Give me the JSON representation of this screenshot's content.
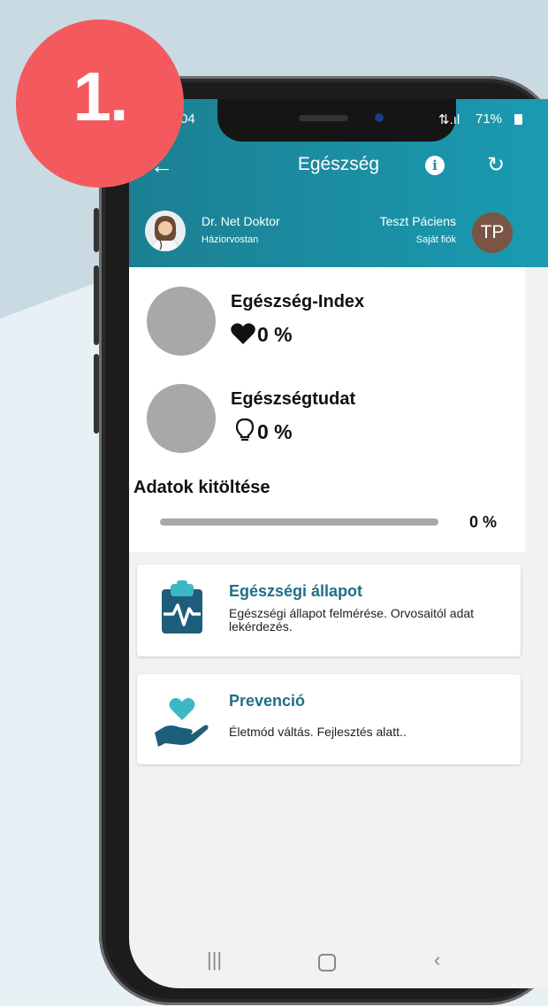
{
  "badge": {
    "number": "1."
  },
  "status_bar": {
    "time": "04",
    "signal": "⇅.ıl",
    "battery": "71%"
  },
  "toolbar": {
    "back_icon": "arrow-left-icon",
    "title": "Egészség",
    "info_icon": "info-icon",
    "refresh_icon": "refresh-icon"
  },
  "doctor": {
    "name": "Dr. Net Doktor",
    "role": "Háziorvostan"
  },
  "patient": {
    "name": "Teszt Páciens",
    "account": "Saját fiók",
    "initials": "TP"
  },
  "metrics": [
    {
      "label": "Egészség-Index",
      "icon": "heart-icon",
      "value": "0 %"
    },
    {
      "label": "Egészségtudat",
      "icon": "lightbulb-icon",
      "value": "0 %"
    }
  ],
  "data_fill": {
    "title": "Adatok kitöltése",
    "value": "0 %",
    "progress": 0
  },
  "features": [
    {
      "title": "Egészségi állapot",
      "description": "Egészségi állapot felmérése. Orvosaitól adat lekérdezés.",
      "icon": "clipboard-pulse-icon"
    },
    {
      "title": "Prevenció",
      "description": "Életmód váltás. Fejlesztés alatt..",
      "icon": "hand-heart-icon"
    }
  ],
  "colors": {
    "accent": "#1a8ea4",
    "badge": "#f45a5d",
    "feature_title": "#1f6f87",
    "icon_teal": "#3cb8c4",
    "icon_navy": "#1e5e7a"
  }
}
